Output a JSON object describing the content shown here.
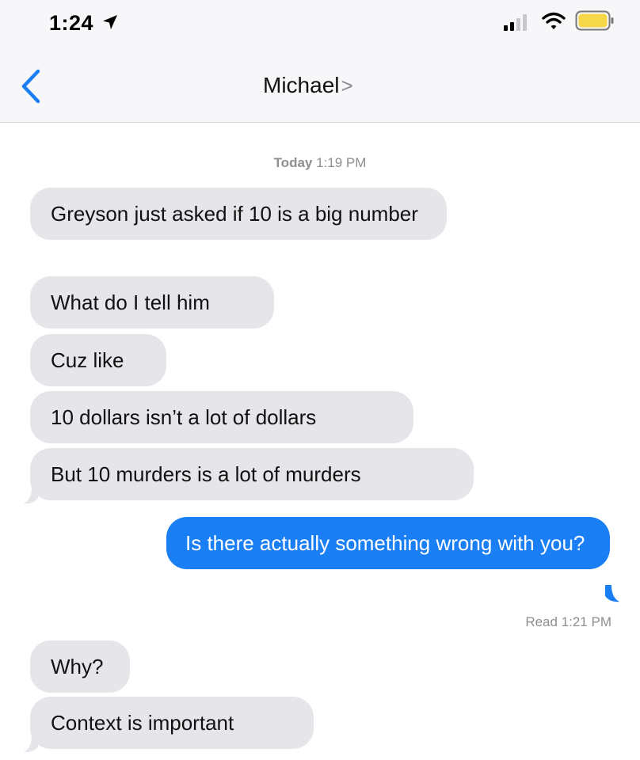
{
  "status_bar": {
    "time": "1:24",
    "icons": [
      "location-arrow-icon",
      "signal-bars-icon",
      "wifi-icon",
      "battery-icon"
    ],
    "battery_color": "#f4d84a"
  },
  "header": {
    "contact_name": "Michael",
    "chevron": ">"
  },
  "conversation": {
    "timestamp_day": "Today",
    "timestamp_time": "1:19 PM",
    "messages": [
      {
        "direction": "incoming",
        "text": "Greyson just asked if 10 is a big number"
      },
      {
        "direction": "incoming",
        "text": "What do I tell him"
      },
      {
        "direction": "incoming",
        "text": "Cuz like"
      },
      {
        "direction": "incoming",
        "text": "10 dollars isn’t a lot of dollars"
      },
      {
        "direction": "incoming",
        "text": "But 10 murders is a lot of murders"
      },
      {
        "direction": "outgoing",
        "text": "Is there actually something wrong with you?"
      },
      {
        "direction": "incoming",
        "text": "Why?"
      },
      {
        "direction": "incoming",
        "text": "Context is important"
      }
    ],
    "read_receipt": "Read 1:21 PM"
  },
  "colors": {
    "incoming_bubble": "#e5e5ea",
    "outgoing_bubble": "#1a7ef5",
    "back_accent": "#1a7ef5"
  }
}
